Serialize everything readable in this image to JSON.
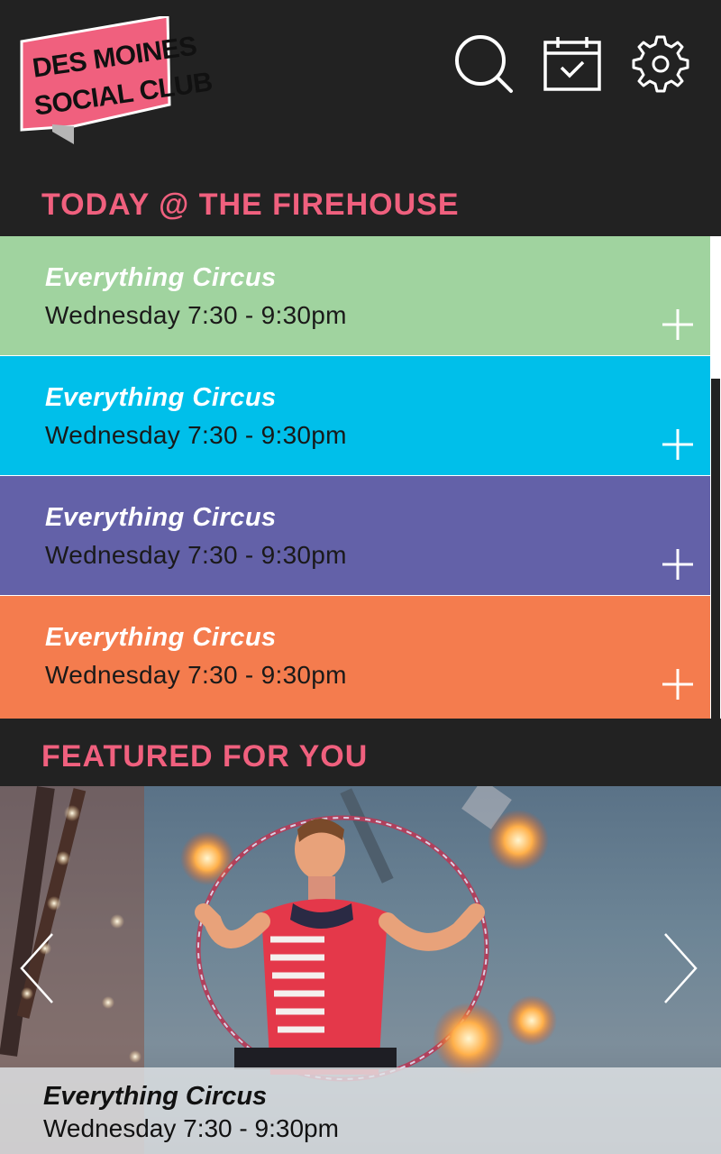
{
  "header": {
    "logo_line1": "DES MOINES",
    "logo_line2": "SOCIAL CLUB",
    "icons": [
      "search-icon",
      "calendar-check-icon",
      "gear-icon"
    ]
  },
  "today_section": {
    "title": "TODAY @ THE FIREHOUSE",
    "events": [
      {
        "title": "Everything Circus",
        "time": "Wednesday 7:30 - 9:30pm",
        "color": "#A0D39F"
      },
      {
        "title": "Everything Circus",
        "time": "Wednesday 7:30 - 9:30pm",
        "color": "#00BFEA"
      },
      {
        "title": "Everything Circus",
        "time": "Wednesday 7:30 - 9:30pm",
        "color": "#6361A8"
      },
      {
        "title": "Everything Circus",
        "time": "Wednesday 7:30 - 9:30pm",
        "color": "#F47C4E"
      }
    ]
  },
  "featured_section": {
    "title": "FEATURED FOR YOU",
    "caption_title": "Everything Circus",
    "caption_time": "Wednesday 7:30 - 9:30pm"
  },
  "colors": {
    "accent": "#F0607E",
    "background": "#222222",
    "logo_pink": "#F0607E"
  }
}
